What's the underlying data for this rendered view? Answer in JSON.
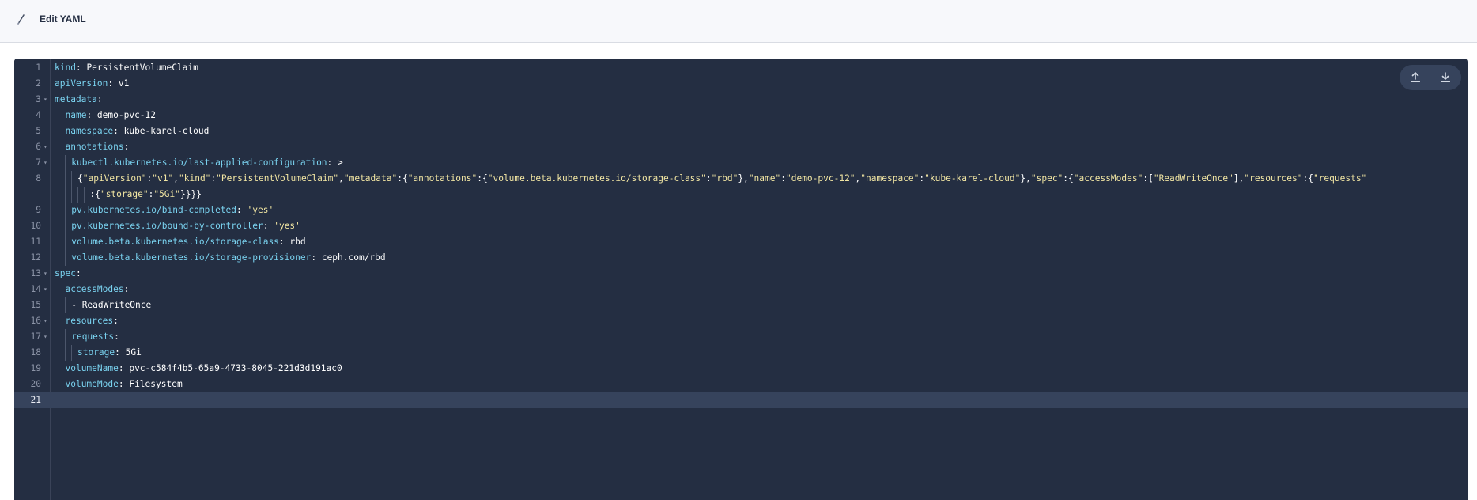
{
  "header": {
    "title": "Edit YAML",
    "icon": "pen-icon"
  },
  "editor": {
    "active_line": 21,
    "toolbar": {
      "upload_icon": "upload-icon",
      "download_icon": "download-icon"
    },
    "lines": [
      {
        "n": "1",
        "fold": false,
        "text": "kind: PersistentVolumeClaim"
      },
      {
        "n": "2",
        "fold": false,
        "text": "apiVersion: v1"
      },
      {
        "n": "3",
        "fold": true,
        "text": "metadata:"
      },
      {
        "n": "4",
        "fold": false,
        "text": "  name: demo-pvc-12"
      },
      {
        "n": "5",
        "fold": false,
        "text": "  namespace: kube-karel-cloud"
      },
      {
        "n": "6",
        "fold": true,
        "text": "  annotations:"
      },
      {
        "n": "7",
        "fold": true,
        "text": "    kubectl.kubernetes.io/last-applied-configuration: >"
      },
      {
        "n": "8",
        "fold": false,
        "text": "      {\"apiVersion\":\"v1\",\"kind\":\"PersistentVolumeClaim\",\"metadata\":{\"annotations\":{\"volume.beta.kubernetes.io/storage-class\":\"rbd\"},\"name\":\"demo-pvc-12\",\"namespace\":\"kube-karel-cloud\"},\"spec\":{\"accessModes\":[\"ReadWriteOnce\"],\"resources\":{\"requests\""
      },
      {
        "n": "",
        "fold": false,
        "text": "          :{\"storage\":\"5Gi\"}}}}"
      },
      {
        "n": "9",
        "fold": false,
        "text": "    pv.kubernetes.io/bind-completed: 'yes'"
      },
      {
        "n": "10",
        "fold": false,
        "text": "    pv.kubernetes.io/bound-by-controller: 'yes'"
      },
      {
        "n": "11",
        "fold": false,
        "text": "    volume.beta.kubernetes.io/storage-class: rbd"
      },
      {
        "n": "12",
        "fold": false,
        "text": "    volume.beta.kubernetes.io/storage-provisioner: ceph.com/rbd"
      },
      {
        "n": "13",
        "fold": true,
        "text": "spec:"
      },
      {
        "n": "14",
        "fold": true,
        "text": "  accessModes:"
      },
      {
        "n": "15",
        "fold": false,
        "text": "    - ReadWriteOnce"
      },
      {
        "n": "16",
        "fold": true,
        "text": "  resources:"
      },
      {
        "n": "17",
        "fold": true,
        "text": "    requests:"
      },
      {
        "n": "18",
        "fold": false,
        "text": "      storage: 5Gi"
      },
      {
        "n": "19",
        "fold": false,
        "text": "  volumeName: pvc-c584f4b5-65a9-4733-8045-221d3d191ac0"
      },
      {
        "n": "20",
        "fold": false,
        "text": "  volumeMode: Filesystem"
      },
      {
        "n": "21",
        "fold": false,
        "text": ""
      }
    ]
  }
}
